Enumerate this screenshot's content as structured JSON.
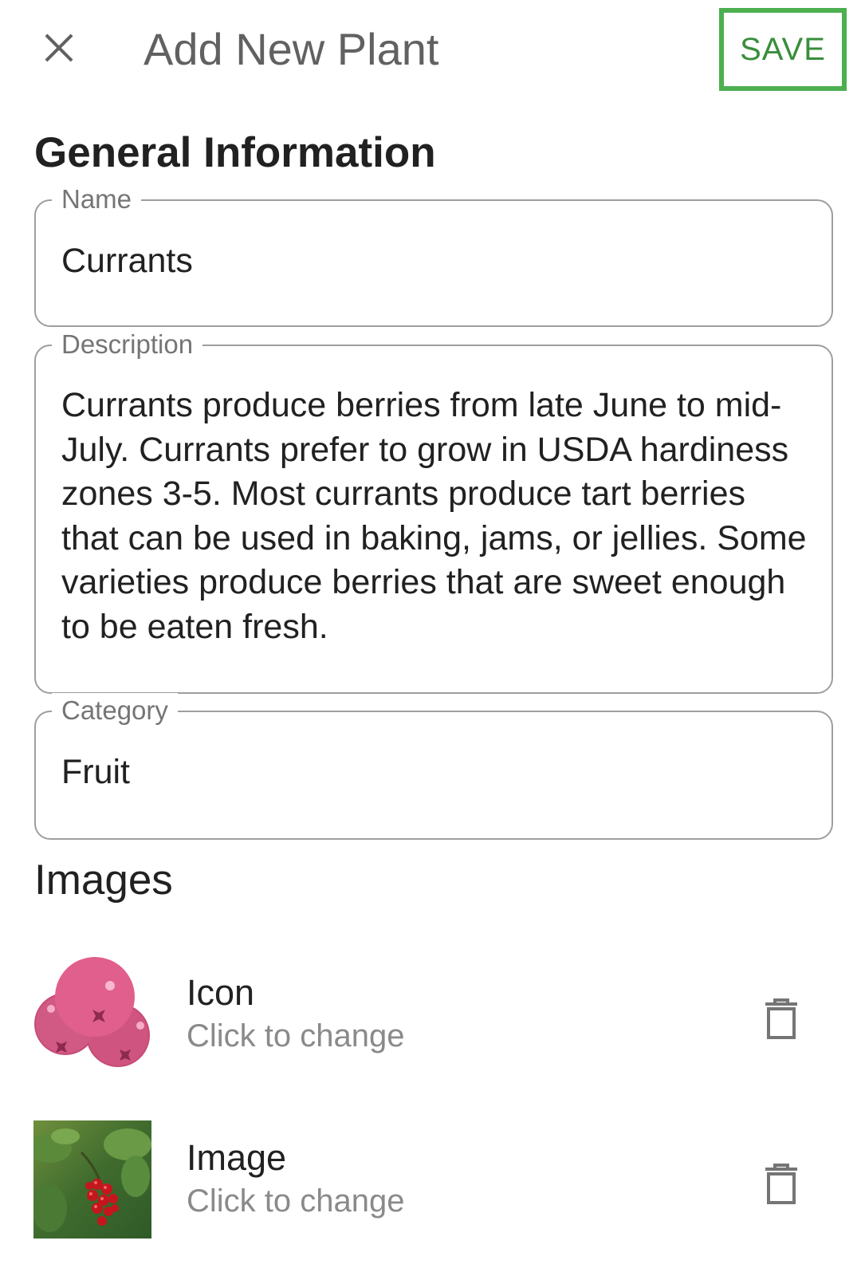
{
  "app_bar": {
    "title": "Add New Plant",
    "save_label": "SAVE",
    "icons": {
      "close": "close-icon"
    },
    "colors": {
      "save_text": "#388e3c",
      "save_outline": "#4caf50"
    }
  },
  "general": {
    "heading": "General Information",
    "name": {
      "label": "Name",
      "value": "Currants"
    },
    "description": {
      "label": "Description",
      "value": "Currants produce berries from late June to mid-July. Currants prefer to grow in USDA hardiness zones 3-5. Most currants produce tart berries that can be used in baking, jams, or jellies. Some varieties produce berries that are sweet enough to be eaten fresh."
    },
    "category": {
      "label": "Category",
      "value": "Fruit"
    }
  },
  "images": {
    "heading": "Images",
    "items": [
      {
        "title": "Icon",
        "subtitle": "Click to change",
        "thumb_icon": "currant-berries-icon",
        "action_icon": "trash-icon"
      },
      {
        "title": "Image",
        "subtitle": "Click to change",
        "thumb_icon": "currant-photo-thumbnail",
        "action_icon": "trash-icon"
      }
    ]
  }
}
